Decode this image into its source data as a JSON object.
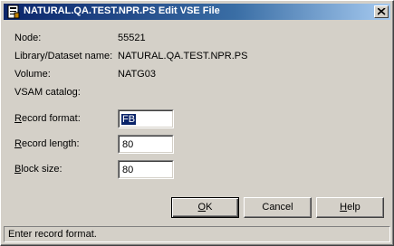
{
  "window": {
    "title": "NATURAL.QA.TEST.NPR.PS Edit VSE File"
  },
  "info": {
    "node_label": "Node:",
    "node_value": "55521",
    "dataset_label": "Library/Dataset name:",
    "dataset_value": "NATURAL.QA.TEST.NPR.PS",
    "volume_label": "Volume:",
    "volume_value": "NATG03",
    "vsam_label": "VSAM catalog:"
  },
  "fields": {
    "record_format": {
      "label_hotkey": "R",
      "label_rest": "ecord format:",
      "value": "FB"
    },
    "record_length": {
      "label_hotkey": "R",
      "label_rest": "ecord length:",
      "value": "80"
    },
    "block_size": {
      "label_hotkey": "B",
      "label_rest": "lock size:",
      "value": "80"
    }
  },
  "buttons": {
    "ok_hotkey": "O",
    "ok_rest": "K",
    "cancel": "Cancel",
    "help_hotkey": "H",
    "help_rest": "elp"
  },
  "status": {
    "text": "Enter record format."
  }
}
